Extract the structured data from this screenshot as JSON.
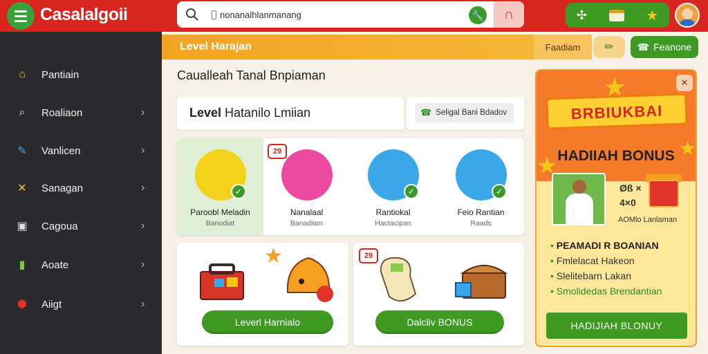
{
  "app": {
    "logo": "Casalalgoii"
  },
  "search": {
    "value": "nonanalhlanmanang"
  },
  "sidebar": {
    "items": [
      {
        "label": "Pantiain",
        "icon": "home-icon",
        "chevron": false
      },
      {
        "label": "Roaliaon",
        "icon": "search-icon",
        "chevron": true
      },
      {
        "label": "Vanlicen",
        "icon": "edit-icon",
        "chevron": true
      },
      {
        "label": "Sanagan",
        "icon": "tools-icon",
        "chevron": true
      },
      {
        "label": "Cagoua",
        "icon": "calendar-icon",
        "chevron": true
      },
      {
        "label": "Aoate",
        "icon": "bottle-icon",
        "chevron": true
      },
      {
        "label": "Aiigt",
        "icon": "bug-icon",
        "chevron": true
      }
    ]
  },
  "level_bar": {
    "title": "Level Harajan",
    "pill": "Faadiam"
  },
  "phone_button": {
    "label": "Feanone"
  },
  "section_title": "Caualleah Tanal Bnpiaman",
  "level_card": {
    "bold": "Level",
    "rest": "Hatanilo Lmiian"
  },
  "select_card": {
    "label": "Seligal Bani Bdadov"
  },
  "categories": [
    {
      "name": "Paroobl Meladin",
      "sub": "Banodiat",
      "color": "#f2d21a",
      "badge": ""
    },
    {
      "name": "Nanalaal",
      "sub": "Banadiam",
      "color": "#ec4aa0",
      "badge": "29"
    },
    {
      "name": "Rantiokal",
      "sub": "Hactacipan",
      "color": "#3aa8e8",
      "badge": ""
    },
    {
      "name": "Feio Rantian",
      "sub": "Raads",
      "color": "#3aa8e8",
      "badge": ""
    }
  ],
  "promos": [
    {
      "button": "Leverl Harnialo",
      "badge": ""
    },
    {
      "button": "Dalcliv BONUS",
      "badge": "29"
    }
  ],
  "bonus": {
    "ribbon": "BRBIUKBAI",
    "title": "HADIIAH BONUS",
    "price_line1": "Øß ×",
    "price_line2": "4×0",
    "caption": "AOMlo Lanlaman",
    "list": [
      "PEAMADI R BOANIAN",
      "Fmlelacat Hakeon",
      "Slelitebarn Lakan",
      "Smolidedas Brendantian"
    ],
    "claim": "HADIJIAH BLONUY"
  },
  "colors": {
    "brand_red": "#d8251f",
    "brand_green": "#3f9a24",
    "accent_orange": "#f2a322",
    "sidebar_bg": "#2b2b2f"
  }
}
